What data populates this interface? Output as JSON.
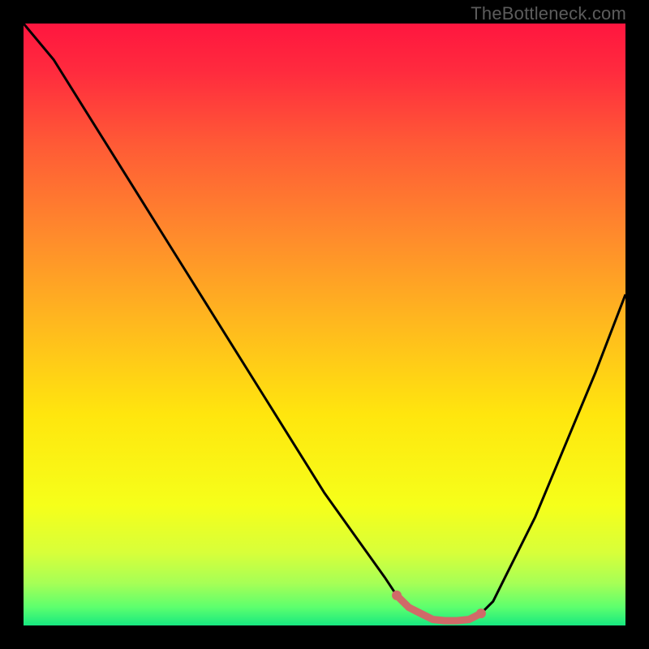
{
  "watermark": "TheBottleneck.com",
  "chart_data": {
    "type": "line",
    "title": "",
    "xlabel": "",
    "ylabel": "",
    "xlim": [
      0,
      100
    ],
    "ylim": [
      0,
      100
    ],
    "series": [
      {
        "name": "bottleneck-curve",
        "x": [
          0,
          5,
          10,
          15,
          20,
          25,
          30,
          35,
          40,
          45,
          50,
          55,
          60,
          62,
          64,
          66,
          68,
          70,
          72,
          74,
          76,
          78,
          80,
          85,
          90,
          95,
          100
        ],
        "y": [
          100,
          94,
          86,
          78,
          70,
          62,
          54,
          46,
          38,
          30,
          22,
          15,
          8,
          5,
          3,
          2,
          1,
          0.8,
          0.8,
          1,
          2,
          4,
          8,
          18,
          30,
          42,
          55
        ]
      },
      {
        "name": "optimal-band",
        "x": [
          62,
          64,
          66,
          68,
          70,
          72,
          74,
          76
        ],
        "y": [
          5,
          3,
          2,
          1,
          0.8,
          0.8,
          1,
          2
        ]
      }
    ],
    "gradient_stops": [
      {
        "offset": 0,
        "color": "#ff163f"
      },
      {
        "offset": 8,
        "color": "#ff2b3e"
      },
      {
        "offset": 20,
        "color": "#ff5a36"
      },
      {
        "offset": 35,
        "color": "#ff8a2c"
      },
      {
        "offset": 50,
        "color": "#ffb91e"
      },
      {
        "offset": 65,
        "color": "#ffe60e"
      },
      {
        "offset": 80,
        "color": "#f6ff1a"
      },
      {
        "offset": 88,
        "color": "#d7ff3a"
      },
      {
        "offset": 93,
        "color": "#a6ff56"
      },
      {
        "offset": 97,
        "color": "#5cff6e"
      },
      {
        "offset": 100,
        "color": "#17e880"
      }
    ]
  }
}
